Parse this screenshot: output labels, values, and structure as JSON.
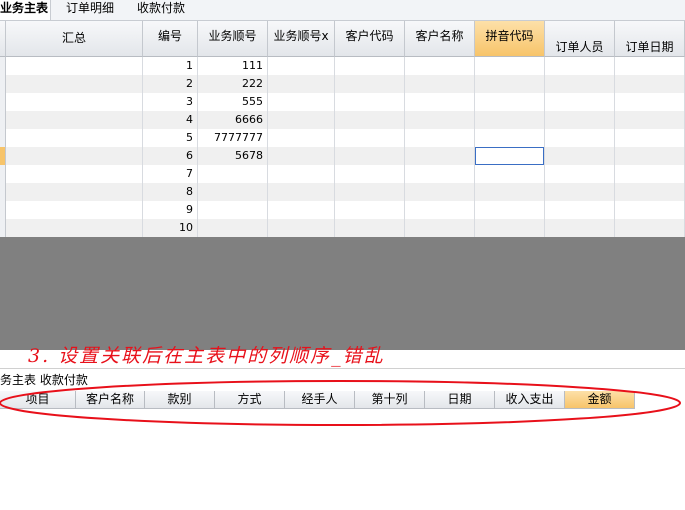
{
  "tabs": [
    {
      "label": "业务主表",
      "active": true
    },
    {
      "label": "订单明细",
      "active": false
    },
    {
      "label": "收款付款",
      "active": false
    }
  ],
  "grid": {
    "columns": [
      "汇总",
      "编号",
      "业务顺号",
      "业务顺号x",
      "客户代码",
      "客户名称",
      "拼音代码",
      "订单人员",
      "订单日期"
    ],
    "rows": [
      {
        "num": "1",
        "seq": "111"
      },
      {
        "num": "2",
        "seq": "222"
      },
      {
        "num": "3",
        "seq": "555"
      },
      {
        "num": "4",
        "seq": "6666"
      },
      {
        "num": "5",
        "seq": "7777777"
      },
      {
        "num": "6",
        "seq": "5678"
      },
      {
        "num": "7",
        "seq": ""
      },
      {
        "num": "8",
        "seq": ""
      },
      {
        "num": "9",
        "seq": ""
      },
      {
        "num": "10",
        "seq": ""
      }
    ]
  },
  "annotation": "3. 设置关联后在主表中的列顺序_错乱",
  "detail": {
    "breadcrumb": "务主表 收款付款",
    "columns": [
      "项目",
      "客户名称",
      "款别",
      "方式",
      "经手人",
      "第十列",
      "日期",
      "收入支出",
      "金额"
    ]
  },
  "colors": {
    "accent": "#f7c46a",
    "annotation": "#e8101a",
    "background": "#808080"
  }
}
